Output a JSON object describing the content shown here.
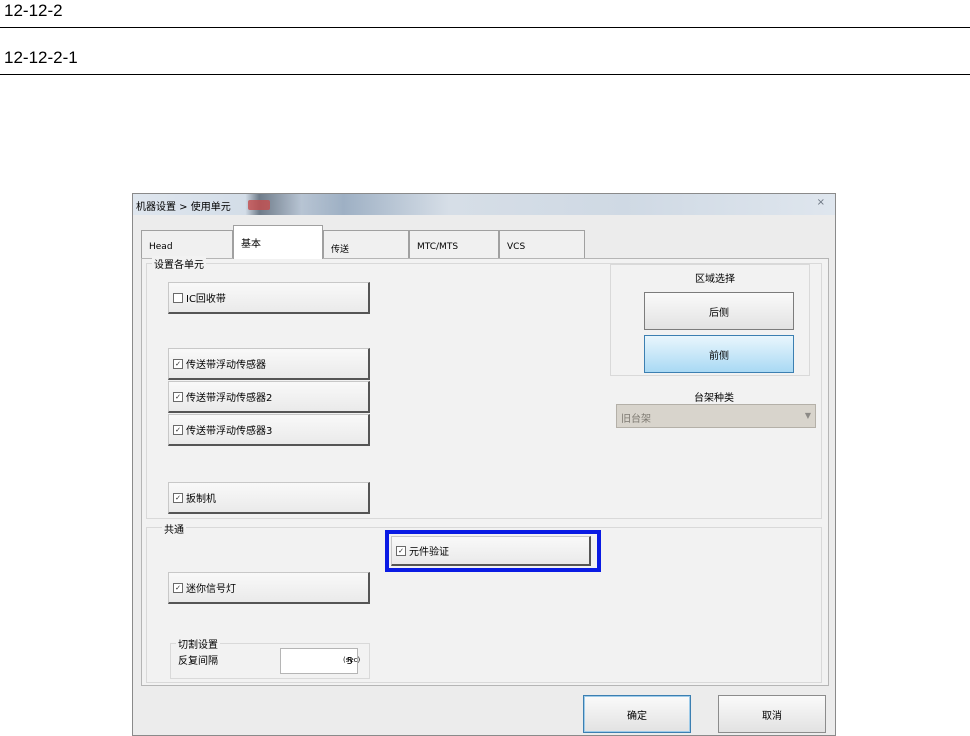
{
  "doc": {
    "heading1": "12-12-2",
    "heading2": "12-12-2-1"
  },
  "window": {
    "title": "机器设置 > 使用单元",
    "close_glyph": "×",
    "tabs": [
      "Head",
      "基本",
      "传送",
      "MTC/MTS",
      "VCS"
    ],
    "active_tab": "基本"
  },
  "units_group": {
    "label": "设置各单元",
    "items": [
      {
        "label": "IC回收带",
        "checked": false
      },
      {
        "label": "传送带浮动传感器",
        "checked": true
      },
      {
        "label": "传送带浮动传感器2",
        "checked": true
      },
      {
        "label": "传送带浮动传感器3",
        "checked": true
      },
      {
        "label": "扳制机",
        "checked": true
      }
    ]
  },
  "zone": {
    "label": "区域选择",
    "rear_label": "后侧",
    "front_label": "前侧",
    "selected": "前侧"
  },
  "rack": {
    "label": "台架种类",
    "value": "旧台架",
    "arrow_glyph": "▼"
  },
  "common_group": {
    "label": "共通",
    "items": [
      {
        "label": "元件验证",
        "checked": true
      },
      {
        "label": "迷你信号灯",
        "checked": true
      }
    ]
  },
  "cut_group": {
    "label": "切割设置",
    "interval_label": "反复间隔",
    "interval_value": "5",
    "unit": "(sec)"
  },
  "buttons": {
    "ok": "确定",
    "cancel": "取消"
  },
  "colors": {
    "highlight": "#0a1be4",
    "selected_button": "#a9d9f4"
  }
}
